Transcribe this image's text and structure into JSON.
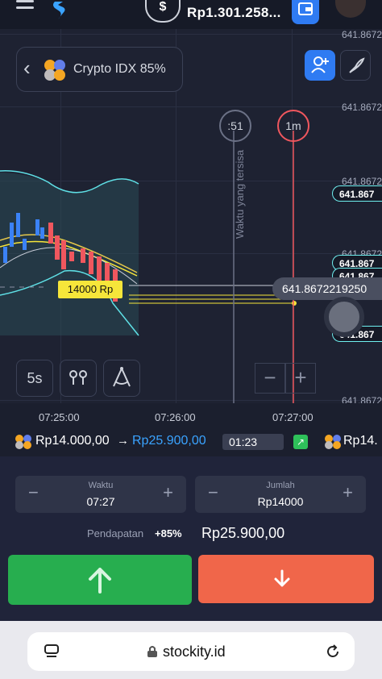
{
  "topbar": {
    "balance": "Rp1.301.258..."
  },
  "chart": {
    "asset_name": "Crypto IDX 85%",
    "price_labels": [
      "641.8672",
      "641.8672",
      "641.8672",
      "641.8672",
      "641.8672"
    ],
    "level_labels": [
      "641.867",
      "641.867",
      "641.867",
      "641.867"
    ],
    "current_price": "641.8672219250",
    "timer_expiry": ":51",
    "timer_period": "1m",
    "remaining_time_label": "Waktu yang tersisa",
    "deal_tag": "14000 Rp",
    "interval_label": "5s",
    "zoom_out": "−",
    "zoom_in": "+"
  },
  "time_axis": [
    "07:25:00",
    "07:26:00",
    "07:27:00"
  ],
  "deals": {
    "amount": "Rp14.000,00",
    "arrow": "→",
    "win": "Rp25.900,00",
    "timer": "01:23",
    "second_amount": "Rp14."
  },
  "trade_panel": {
    "time_label": "Waktu",
    "time_value": "07:27",
    "amount_label": "Jumlah",
    "amount_value": "Rp14000",
    "minus": "−",
    "plus": "+",
    "payout_label": "Pendapatan",
    "payout_percent": "+85%",
    "payout_value": "Rp25.900,00"
  },
  "browser": {
    "url": "stockity.id"
  },
  "colors": {
    "up": "#27ae4f",
    "down": "#f0664a",
    "accent": "#2f7bf2",
    "deal": "#f6e63a"
  }
}
